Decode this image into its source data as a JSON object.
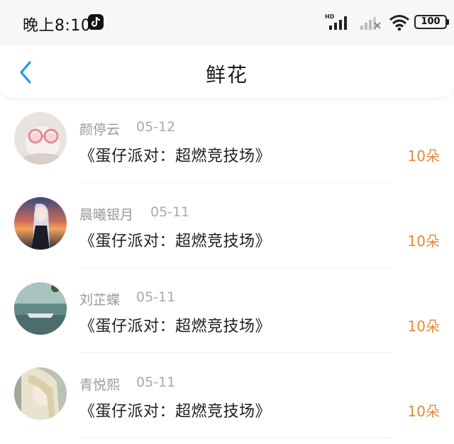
{
  "status_bar": {
    "time": "晚上8:10",
    "battery": "100",
    "network_label": "HD",
    "icons": [
      "tiktok-icon",
      "hd-signal-icon",
      "signal-icon",
      "wifi-icon",
      "battery-icon"
    ]
  },
  "header": {
    "title": "鲜花",
    "back_icon": "chevron-left-icon",
    "back_color": "#2196f3"
  },
  "colors": {
    "count": "#e58a3c",
    "name": "#9a9a9a"
  },
  "items": [
    {
      "name": "颜停云",
      "date": "05-12",
      "gift": "《蛋仔派对：超燃竞技场》",
      "count": "10朵"
    },
    {
      "name": "晨曦银月",
      "date": "05-11",
      "gift": "《蛋仔派对：超燃竞技场》",
      "count": "10朵"
    },
    {
      "name": "刘芷蝶",
      "date": "05-11",
      "gift": "《蛋仔派对：超燃竞技场》",
      "count": "10朵"
    },
    {
      "name": "青悦熙",
      "date": "05-11",
      "gift": "《蛋仔派对：超燃竞技场》",
      "count": "10朵"
    }
  ]
}
